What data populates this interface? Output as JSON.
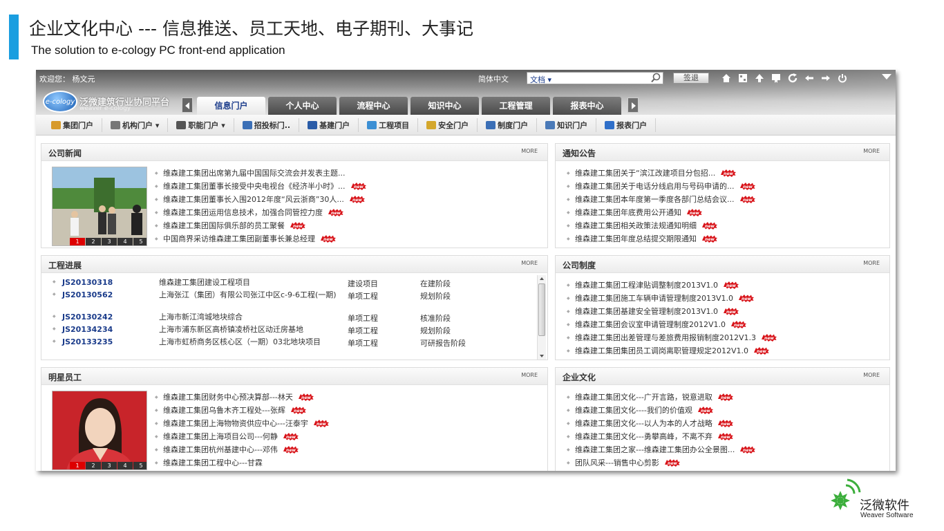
{
  "slide": {
    "title": "企业文化中心 --- 信息推送、员工天地、电子期刊、大事记",
    "subtitle": "The solution to e-cology PC front-end application",
    "brand_cn": "泛微软件",
    "brand_en": "Weaver Software"
  },
  "header": {
    "welcome": "欢迎您： 杨文元",
    "language": "简体中文",
    "search_select": "文档 ▾",
    "logout": "签退",
    "logo_text": "e-cology",
    "platform_name": "泛微建筑行业协同平台",
    "platform_sub": "weaver e-cology"
  },
  "main_tabs": [
    {
      "label": "信息门户",
      "active": true
    },
    {
      "label": "个人中心",
      "active": false
    },
    {
      "label": "流程中心",
      "active": false
    },
    {
      "label": "知识中心",
      "active": false
    },
    {
      "label": "工程管理",
      "active": false
    },
    {
      "label": "报表中心",
      "active": false
    }
  ],
  "sub_nav": [
    {
      "label": "集团门户",
      "color": "#d79a2b"
    },
    {
      "label": "机构门户 ▾",
      "color": "#777777"
    },
    {
      "label": "职能门户 ▾",
      "color": "#555555"
    },
    {
      "label": "招投标门..",
      "color": "#3b6fb6"
    },
    {
      "label": "基建门户",
      "color": "#2a5ca8"
    },
    {
      "label": "工程项目",
      "color": "#3c8fd4"
    },
    {
      "label": "安全门户",
      "color": "#d4a72c"
    },
    {
      "label": "制度门户",
      "color": "#3b6fb6"
    },
    {
      "label": "知识门户",
      "color": "#4a7ab8"
    },
    {
      "label": "报表门户",
      "color": "#2f6fc9"
    }
  ],
  "more_label": "MORE",
  "photo_pages": [
    "1",
    "2",
    "3",
    "4",
    "5"
  ],
  "company_news": {
    "title": "公司新闻",
    "items": [
      {
        "text": "维森建工集团出席第九届中国国际交流会并发表主题...",
        "new": false
      },
      {
        "text": "维森建工集团董事长接受中央电视台《经济半小时》...",
        "new": true
      },
      {
        "text": "维森建工集团董事长入围2012年度“风云浙商”30人...",
        "new": true
      },
      {
        "text": "维森建工集团运用信息技术，加强合同管控力度",
        "new": true
      },
      {
        "text": "维森建工集团国际俱乐部的员工聚餐",
        "new": true
      },
      {
        "text": "中国商界采访维森建工集团副董事长兼总经理",
        "new": true
      }
    ]
  },
  "notices": {
    "title": "通知公告",
    "items": [
      {
        "text": "维森建工集团关于“滨江改建项目分包招...",
        "new": true
      },
      {
        "text": "维森建工集团关于电话分线启用与号码申请的...",
        "new": true
      },
      {
        "text": "维森建工集团本年度第一季度各部门总结会议...",
        "new": true
      },
      {
        "text": "维森建工集团年底费用公开通知",
        "new": true
      },
      {
        "text": "维森建工集团相关政策法规通知明细",
        "new": true
      },
      {
        "text": "维森建工集团年度总结提交期限通知",
        "new": true
      }
    ]
  },
  "projects": {
    "title": "工程进展",
    "rows": [
      {
        "code": "JS20130318",
        "name": "维森建工集团建设工程项目",
        "type": "建设项目",
        "stage": "在建阶段"
      },
      {
        "code": "JS20130562",
        "name": "上海张江（集团）有限公司张江中区c-9-6工程(一期)",
        "type": "单项工程",
        "stage": "规划阶段"
      },
      {
        "code": "JS20130242",
        "name": "上海市新江湾城地块综合",
        "type": "单项工程",
        "stage": "核准阶段"
      },
      {
        "code": "JS20134234",
        "name": "上海市浦东新区高桥镇凌桥社区动迁房基地",
        "type": "单项工程",
        "stage": "规划阶段"
      },
      {
        "code": "JS20133235",
        "name": "上海市虹桥商务区核心区（一期）03北地块项目",
        "type": "单项工程",
        "stage": "可研报告阶段"
      }
    ]
  },
  "regulations": {
    "title": "公司制度",
    "items": [
      {
        "text": "维森建工集团工程津贴调整制度2013V1.0",
        "new": true
      },
      {
        "text": "维森建工集团施工车辆申请管理制度2013V1.0",
        "new": true
      },
      {
        "text": "维森建工集团基建安全管理制度2013V1.0",
        "new": true
      },
      {
        "text": "维森建工集团会议室申请管理制度2012V1.0",
        "new": true
      },
      {
        "text": "维森建工集团出差管理与差旅费用报销制度2012V1.3",
        "new": true
      },
      {
        "text": "维森建工集团集团员工调岗离职管理规定2012V1.0",
        "new": true
      }
    ]
  },
  "star_staff": {
    "title": "明星员工",
    "items": [
      {
        "text": "维森建工集团财务中心预决算部---林天",
        "new": true
      },
      {
        "text": "维森建工集团乌鲁木齐工程处---张辉",
        "new": true
      },
      {
        "text": "维森建工集团上海物物资供应中心---汪泰宇",
        "new": true
      },
      {
        "text": "维森建工集团上海项目公司---何静",
        "new": true
      },
      {
        "text": "维森建工集团杭州基建中心---邓伟",
        "new": true
      },
      {
        "text": "维森建工集团工程中心---甘霖",
        "new": false
      }
    ]
  },
  "culture": {
    "title": "企业文化",
    "items": [
      {
        "text": "维森建工集团文化---广开言路，锐意进取",
        "new": true
      },
      {
        "text": "维森建工集团文化----我们的价值观",
        "new": true
      },
      {
        "text": "维森建工集团文化---以人为本的人才战略",
        "new": true
      },
      {
        "text": "维森建工集团文化---勇攀高峰，不离不弃",
        "new": true
      },
      {
        "text": "维森建工集团之家---维森建工集团办公全景图...",
        "new": true
      },
      {
        "text": "团队风采---销售中心剪影",
        "new": true
      }
    ]
  }
}
